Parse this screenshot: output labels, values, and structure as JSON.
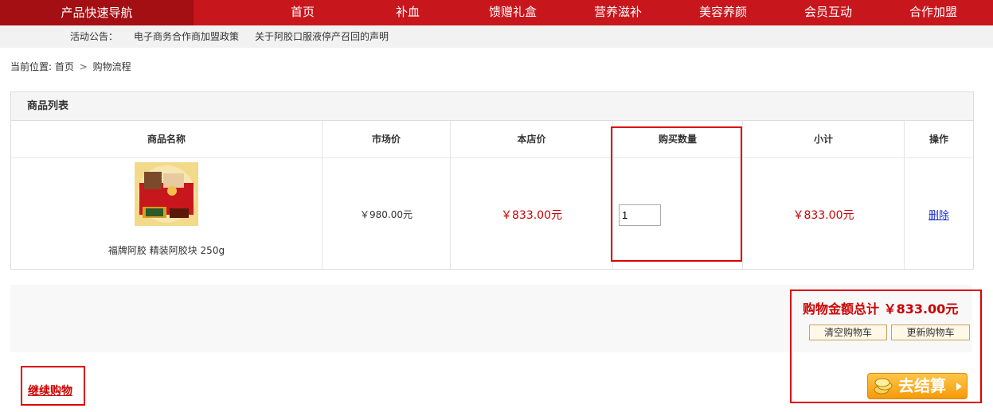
{
  "nav": {
    "quick_nav": "产品快速导航",
    "items": [
      "首页",
      "补血",
      "馈赠礼盒",
      "营养滋补",
      "美容养颜",
      "会员互动",
      "合作加盟"
    ]
  },
  "notice": {
    "label": "活动公告：",
    "items": [
      "电子商务合作商加盟政策",
      "关于阿胶口服液停产召回的声明"
    ]
  },
  "breadcrumb": {
    "prefix": "当前位置:",
    "home": "首页",
    "current": "购物流程"
  },
  "panel": {
    "title": "商品列表",
    "headers": [
      "商品名称",
      "市场价",
      "本店价",
      "购买数量",
      "小计",
      "操作"
    ]
  },
  "product": {
    "name": "福牌阿胶 精装阿胶块 250g",
    "market_price": "￥980.00元",
    "shop_price": "￥833.00元",
    "quantity": "1",
    "subtotal": "￥833.00元",
    "delete_label": "删除"
  },
  "summary": {
    "total_label": "购物金额总计 ￥833.00元",
    "clear_label": "清空购物车",
    "update_label": "更新购物车",
    "checkout_label": "去结算",
    "continue_label": "继续购物"
  },
  "colors": {
    "nav_red": "#c8161d",
    "price_red": "#cc0000",
    "link_blue": "#1a33cc"
  }
}
